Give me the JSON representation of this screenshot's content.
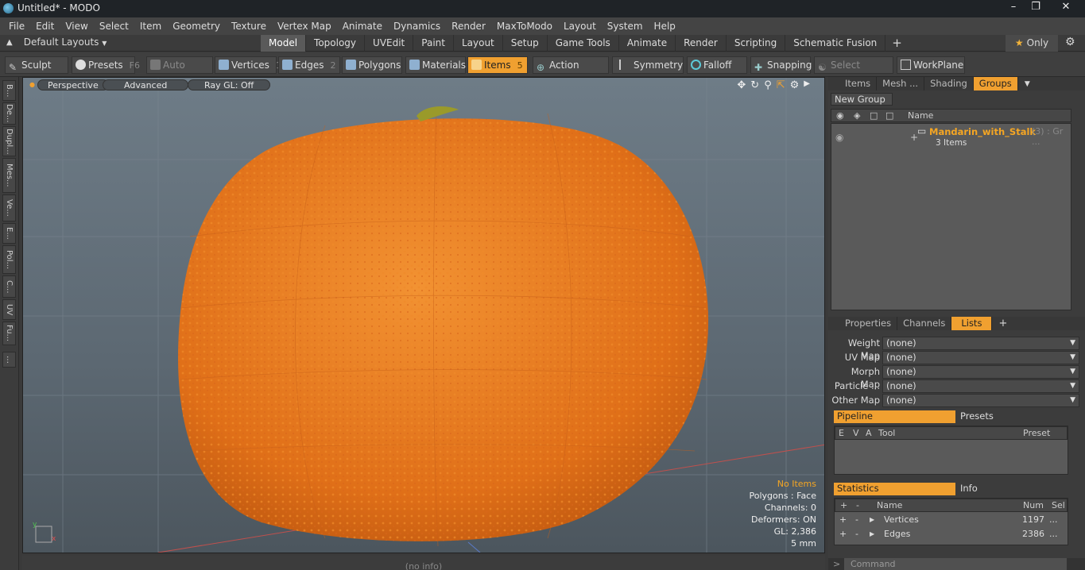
{
  "window": {
    "title": "Untitled* - MODO"
  },
  "menu": [
    "File",
    "Edit",
    "View",
    "Select",
    "Item",
    "Geometry",
    "Texture",
    "Vertex Map",
    "Animate",
    "Dynamics",
    "Render",
    "MaxToModo",
    "Layout",
    "System",
    "Help"
  ],
  "layout_bar": {
    "layouts_label": "Default Layouts",
    "tabs": [
      "Model",
      "Topology",
      "UVEdit",
      "Paint",
      "Layout",
      "Setup",
      "Game Tools",
      "Animate",
      "Render",
      "Scripting",
      "Schematic Fusion"
    ],
    "active_tab": "Model",
    "plus": "+",
    "only_label": "Only"
  },
  "toolbar": {
    "sculpt": "Sculpt",
    "presets": "Presets",
    "presets_key": "F6",
    "auto_select": "Auto Select",
    "vertices": "Vertices",
    "vertices_key": "1",
    "edges": "Edges",
    "edges_key": "2",
    "polygons": "Polygons",
    "materials": "Materials",
    "items": "Items",
    "items_key": "5",
    "action_center": "Action Center",
    "symmetry": "Symmetry",
    "falloff": "Falloff",
    "snapping": "Snapping",
    "select_through": "Select Through",
    "workplane": "WorkPlane"
  },
  "left_tabs": [
    "B...",
    "De...",
    "Dupl...",
    "Mes...",
    "Ve...",
    "E...",
    "Pol...",
    "C...",
    "UV",
    "Fu..."
  ],
  "viewport": {
    "perspective": "Perspective",
    "advanced": "Advanced",
    "raygl": "Ray GL: Off",
    "info": {
      "items": "No Items",
      "polygons": "Polygons : Face",
      "channels": "Channels: 0",
      "deformers": "Deformers: ON",
      "gl": "GL: 2,386",
      "scale": "5 mm"
    },
    "status": "(no info)"
  },
  "groups_panel": {
    "tabs": [
      "Items",
      "Mesh ...",
      "Shading",
      "Groups"
    ],
    "active_tab": "Groups",
    "new_group": "New Group",
    "col_name": "Name",
    "group_name": "Mandarin_with_Stalk",
    "group_suffix": "(3) : Gr ...",
    "group_count": "3 Items"
  },
  "lists_panel": {
    "tabs": [
      "Properties",
      "Channels",
      "Lists"
    ],
    "active_tab": "Lists",
    "rows": [
      {
        "label": "Weight Map",
        "value": "(none)"
      },
      {
        "label": "UV Map",
        "value": "(none)"
      },
      {
        "label": "Morph Map",
        "value": "(none)"
      },
      {
        "label": "Particle ...",
        "value": "(none)"
      },
      {
        "label": "Other Map",
        "value": "(none)"
      }
    ],
    "pipeline": "Pipeline",
    "presets": "Presets",
    "pipe_cols": [
      "E",
      "V",
      "A",
      "Tool",
      "Preset"
    ],
    "statistics": "Statistics",
    "info": "Info",
    "stat_cols": [
      "Name",
      "Num",
      "Sel"
    ],
    "stats": [
      {
        "name": "Vertices",
        "num": "1197",
        "sel": "..."
      },
      {
        "name": "Edges",
        "num": "2386",
        "sel": "..."
      }
    ]
  },
  "command": {
    "placeholder": "Command",
    "prompt": ">"
  },
  "colors": {
    "accent": "#f0a030",
    "orange_text": "#f5a623",
    "mandarin": "#e8761c"
  }
}
